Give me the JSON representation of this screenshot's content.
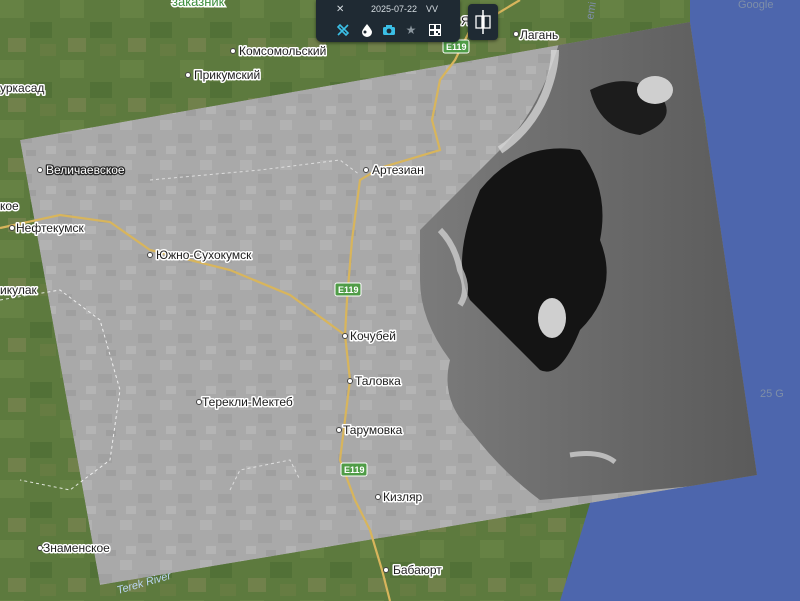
{
  "map": {
    "places": [
      {
        "id": "zakaznik",
        "text": "заказник"
      },
      {
        "id": "komsomolsky",
        "text": "Комсомольский"
      },
      {
        "id": "prikumsky",
        "text": "Прикумский"
      },
      {
        "id": "urkasad",
        "text": "уркасад"
      },
      {
        "id": "velichaevskoe",
        "text": "Величаевское"
      },
      {
        "id": "neftekumsk",
        "text": "Нефтекумск"
      },
      {
        "id": "koe",
        "text": "кое"
      },
      {
        "id": "yuzhno",
        "text": "Южно-Сухокумск"
      },
      {
        "id": "kulak",
        "text": "икулак"
      },
      {
        "id": "artezian",
        "text": "Артезиан"
      },
      {
        "id": "kochubey",
        "text": "Кочубей"
      },
      {
        "id": "talovka",
        "text": "Таловка"
      },
      {
        "id": "terekli",
        "text": "Терекли-Мектеб"
      },
      {
        "id": "tarumovka",
        "text": "Тарумовка"
      },
      {
        "id": "kizlyar",
        "text": "Кизляр"
      },
      {
        "id": "znamenskoe",
        "text": "Знаменское"
      },
      {
        "id": "babayurt",
        "text": "Бабаюрт"
      },
      {
        "id": "lagan",
        "text": "Лагань"
      }
    ],
    "road_shields": [
      "E119",
      "E119",
      "E119"
    ],
    "river_label": "Terek River",
    "google_text": "Google",
    "partial_labels": {
      "top_right": "emi",
      "right_edge": "25 G",
      "top_char": "Я"
    }
  },
  "toolbar": {
    "tools_icon": "tools-icon",
    "date": "2025-07-22",
    "polarization": "VV",
    "icons": [
      "satellite-icon",
      "droplet-icon",
      "camera-icon",
      "star-icon",
      "qr-icon"
    ]
  },
  "compare_button": {
    "icon": "split-compare-icon"
  },
  "colors": {
    "sea": "#4d66ad",
    "land": "#5d7a3e",
    "road": "#d8b55c",
    "toolbar_bg": "#1f2a33",
    "icon_accent": "#3bbfe6",
    "shield": "#4f9c47"
  }
}
